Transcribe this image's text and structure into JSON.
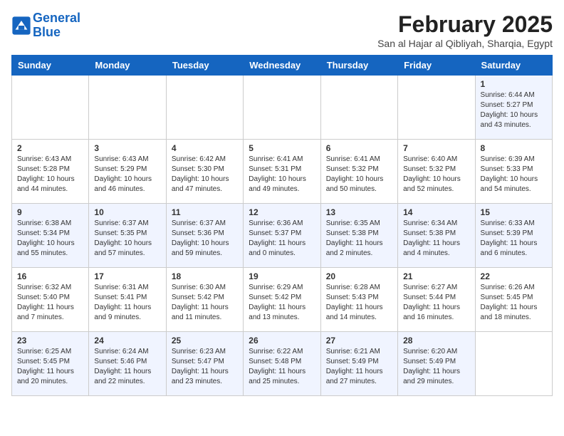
{
  "header": {
    "logo_line1": "General",
    "logo_line2": "Blue",
    "month_title": "February 2025",
    "subtitle": "San al Hajar al Qibliyah, Sharqia, Egypt"
  },
  "days_of_week": [
    "Sunday",
    "Monday",
    "Tuesday",
    "Wednesday",
    "Thursday",
    "Friday",
    "Saturday"
  ],
  "weeks": [
    [
      {
        "day": "",
        "info": ""
      },
      {
        "day": "",
        "info": ""
      },
      {
        "day": "",
        "info": ""
      },
      {
        "day": "",
        "info": ""
      },
      {
        "day": "",
        "info": ""
      },
      {
        "day": "",
        "info": ""
      },
      {
        "day": "1",
        "info": "Sunrise: 6:44 AM\nSunset: 5:27 PM\nDaylight: 10 hours\nand 43 minutes."
      }
    ],
    [
      {
        "day": "2",
        "info": "Sunrise: 6:43 AM\nSunset: 5:28 PM\nDaylight: 10 hours\nand 44 minutes."
      },
      {
        "day": "3",
        "info": "Sunrise: 6:43 AM\nSunset: 5:29 PM\nDaylight: 10 hours\nand 46 minutes."
      },
      {
        "day": "4",
        "info": "Sunrise: 6:42 AM\nSunset: 5:30 PM\nDaylight: 10 hours\nand 47 minutes."
      },
      {
        "day": "5",
        "info": "Sunrise: 6:41 AM\nSunset: 5:31 PM\nDaylight: 10 hours\nand 49 minutes."
      },
      {
        "day": "6",
        "info": "Sunrise: 6:41 AM\nSunset: 5:32 PM\nDaylight: 10 hours\nand 50 minutes."
      },
      {
        "day": "7",
        "info": "Sunrise: 6:40 AM\nSunset: 5:32 PM\nDaylight: 10 hours\nand 52 minutes."
      },
      {
        "day": "8",
        "info": "Sunrise: 6:39 AM\nSunset: 5:33 PM\nDaylight: 10 hours\nand 54 minutes."
      }
    ],
    [
      {
        "day": "9",
        "info": "Sunrise: 6:38 AM\nSunset: 5:34 PM\nDaylight: 10 hours\nand 55 minutes."
      },
      {
        "day": "10",
        "info": "Sunrise: 6:37 AM\nSunset: 5:35 PM\nDaylight: 10 hours\nand 57 minutes."
      },
      {
        "day": "11",
        "info": "Sunrise: 6:37 AM\nSunset: 5:36 PM\nDaylight: 10 hours\nand 59 minutes."
      },
      {
        "day": "12",
        "info": "Sunrise: 6:36 AM\nSunset: 5:37 PM\nDaylight: 11 hours\nand 0 minutes."
      },
      {
        "day": "13",
        "info": "Sunrise: 6:35 AM\nSunset: 5:38 PM\nDaylight: 11 hours\nand 2 minutes."
      },
      {
        "day": "14",
        "info": "Sunrise: 6:34 AM\nSunset: 5:38 PM\nDaylight: 11 hours\nand 4 minutes."
      },
      {
        "day": "15",
        "info": "Sunrise: 6:33 AM\nSunset: 5:39 PM\nDaylight: 11 hours\nand 6 minutes."
      }
    ],
    [
      {
        "day": "16",
        "info": "Sunrise: 6:32 AM\nSunset: 5:40 PM\nDaylight: 11 hours\nand 7 minutes."
      },
      {
        "day": "17",
        "info": "Sunrise: 6:31 AM\nSunset: 5:41 PM\nDaylight: 11 hours\nand 9 minutes."
      },
      {
        "day": "18",
        "info": "Sunrise: 6:30 AM\nSunset: 5:42 PM\nDaylight: 11 hours\nand 11 minutes."
      },
      {
        "day": "19",
        "info": "Sunrise: 6:29 AM\nSunset: 5:42 PM\nDaylight: 11 hours\nand 13 minutes."
      },
      {
        "day": "20",
        "info": "Sunrise: 6:28 AM\nSunset: 5:43 PM\nDaylight: 11 hours\nand 14 minutes."
      },
      {
        "day": "21",
        "info": "Sunrise: 6:27 AM\nSunset: 5:44 PM\nDaylight: 11 hours\nand 16 minutes."
      },
      {
        "day": "22",
        "info": "Sunrise: 6:26 AM\nSunset: 5:45 PM\nDaylight: 11 hours\nand 18 minutes."
      }
    ],
    [
      {
        "day": "23",
        "info": "Sunrise: 6:25 AM\nSunset: 5:45 PM\nDaylight: 11 hours\nand 20 minutes."
      },
      {
        "day": "24",
        "info": "Sunrise: 6:24 AM\nSunset: 5:46 PM\nDaylight: 11 hours\nand 22 minutes."
      },
      {
        "day": "25",
        "info": "Sunrise: 6:23 AM\nSunset: 5:47 PM\nDaylight: 11 hours\nand 23 minutes."
      },
      {
        "day": "26",
        "info": "Sunrise: 6:22 AM\nSunset: 5:48 PM\nDaylight: 11 hours\nand 25 minutes."
      },
      {
        "day": "27",
        "info": "Sunrise: 6:21 AM\nSunset: 5:49 PM\nDaylight: 11 hours\nand 27 minutes."
      },
      {
        "day": "28",
        "info": "Sunrise: 6:20 AM\nSunset: 5:49 PM\nDaylight: 11 hours\nand 29 minutes."
      },
      {
        "day": "",
        "info": ""
      }
    ]
  ]
}
